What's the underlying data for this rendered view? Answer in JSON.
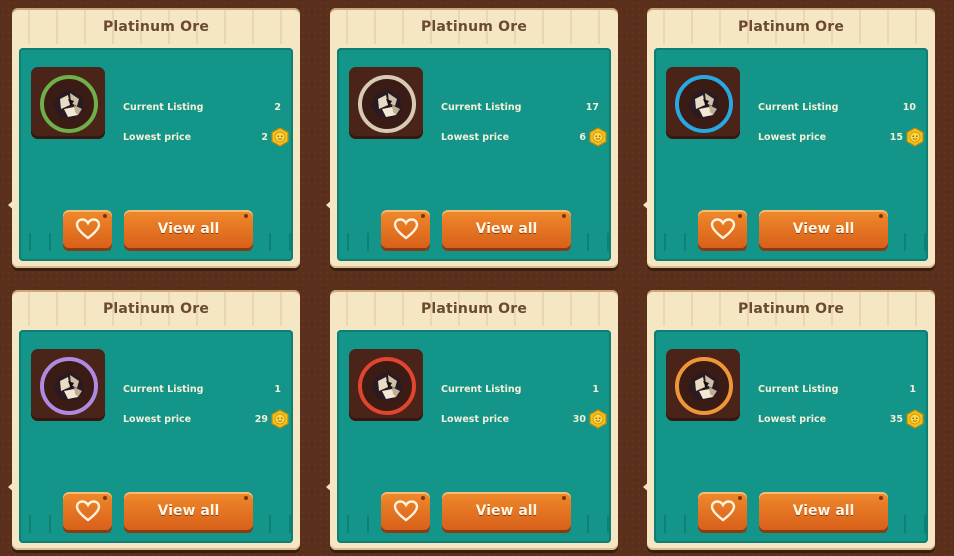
{
  "listings": [
    {
      "title": "Platinum Ore",
      "current_listing_label": "Current Listing",
      "current_listing": "2",
      "lowest_price_label": "Lowest price",
      "lowest_price": "2",
      "rarity_color": "#6fb04a",
      "view_label": "View all"
    },
    {
      "title": "Platinum Ore",
      "current_listing_label": "Current Listing",
      "current_listing": "17",
      "lowest_price_label": "Lowest price",
      "lowest_price": "6",
      "rarity_color": "#d9cbb3",
      "view_label": "View all"
    },
    {
      "title": "Platinum Ore",
      "current_listing_label": "Current Listing",
      "current_listing": "10",
      "lowest_price_label": "Lowest price",
      "lowest_price": "15",
      "rarity_color": "#2aa6e0",
      "view_label": "View all"
    },
    {
      "title": "Platinum Ore",
      "current_listing_label": "Current Listing",
      "current_listing": "1",
      "lowest_price_label": "Lowest price",
      "lowest_price": "29",
      "rarity_color": "#b08ae0",
      "view_label": "View all"
    },
    {
      "title": "Platinum Ore",
      "current_listing_label": "Current Listing",
      "current_listing": "1",
      "lowest_price_label": "Lowest price",
      "lowest_price": "30",
      "rarity_color": "#e2452f",
      "view_label": "View all"
    },
    {
      "title": "Platinum Ore",
      "current_listing_label": "Current Listing",
      "current_listing": "1",
      "lowest_price_label": "Lowest price",
      "lowest_price": "35",
      "rarity_color": "#f0953a",
      "view_label": "View all"
    }
  ],
  "icons": {
    "favorite": "heart-icon",
    "currency": "coin-icon",
    "item": "platinum-ore-icon"
  },
  "colors": {
    "panel": "#13958a",
    "button": "#e8731f",
    "card": "#f5e6c4",
    "background": "#5a2f1c"
  }
}
